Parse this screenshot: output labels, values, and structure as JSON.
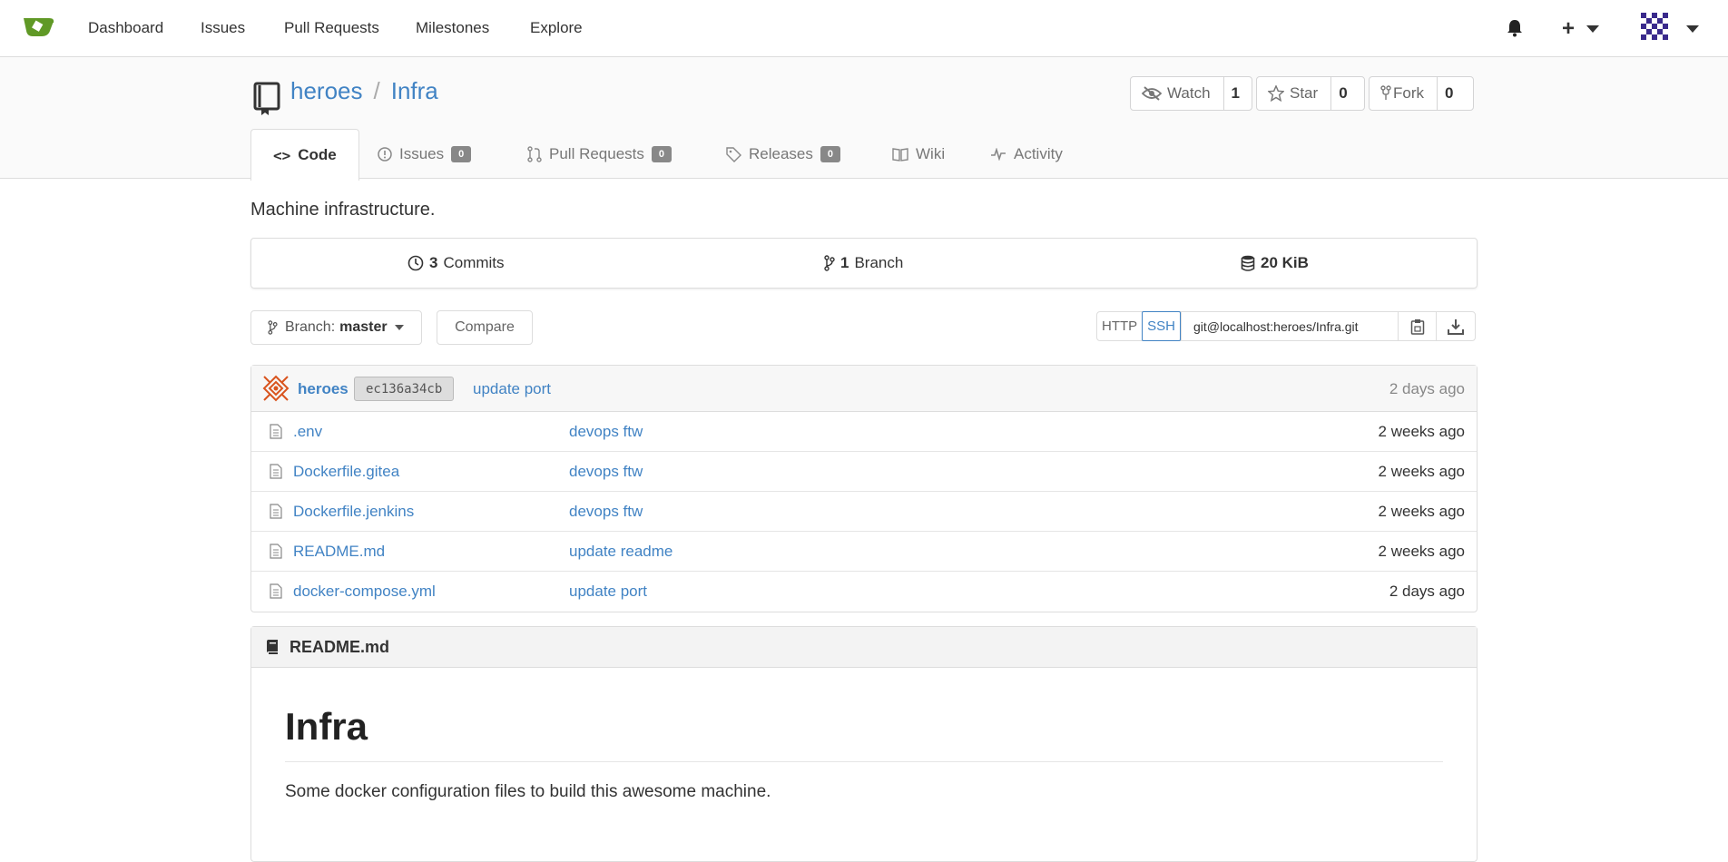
{
  "nav": {
    "items": [
      "Dashboard",
      "Issues",
      "Pull Requests",
      "Milestones",
      "Explore"
    ],
    "plus": "+"
  },
  "repo": {
    "owner": "heroes",
    "separator": "/",
    "name": "Infra",
    "watch": {
      "label": "Watch",
      "count": "1"
    },
    "star": {
      "label": "Star",
      "count": "0"
    },
    "fork": {
      "label": "Fork",
      "count": "0"
    },
    "description": "Machine infrastructure."
  },
  "tabs": [
    {
      "label": "Code",
      "badge": null
    },
    {
      "label": "Issues",
      "badge": "0"
    },
    {
      "label": "Pull Requests",
      "badge": "0"
    },
    {
      "label": "Releases",
      "badge": "0"
    },
    {
      "label": "Wiki",
      "badge": null
    },
    {
      "label": "Activity",
      "badge": null
    }
  ],
  "stats": {
    "commits": {
      "count": "3",
      "label": "Commits"
    },
    "branches": {
      "count": "1",
      "label": "Branch"
    },
    "size": "20 KiB"
  },
  "branch": {
    "prefix": "Branch:",
    "name": "master",
    "compare": "Compare"
  },
  "clone": {
    "http": "HTTP",
    "ssh": "SSH",
    "url": "git@localhost:heroes/Infra.git"
  },
  "latest_commit": {
    "author": "heroes",
    "sha": "ec136a34cb",
    "message": "update port",
    "when": "2 days ago"
  },
  "files": [
    {
      "name": ".env",
      "message": "devops ftw",
      "when": "2 weeks ago"
    },
    {
      "name": "Dockerfile.gitea",
      "message": "devops ftw",
      "when": "2 weeks ago"
    },
    {
      "name": "Dockerfile.jenkins",
      "message": "devops ftw",
      "when": "2 weeks ago"
    },
    {
      "name": "README.md",
      "message": "update readme",
      "when": "2 weeks ago"
    },
    {
      "name": "docker-compose.yml",
      "message": "update port",
      "when": "2 days ago"
    }
  ],
  "readme": {
    "filename": "README.md",
    "heading": "Infra",
    "body": "Some docker configuration files to build this awesome machine."
  },
  "colors": {
    "link": "#4183c4",
    "logo": "#609926"
  }
}
